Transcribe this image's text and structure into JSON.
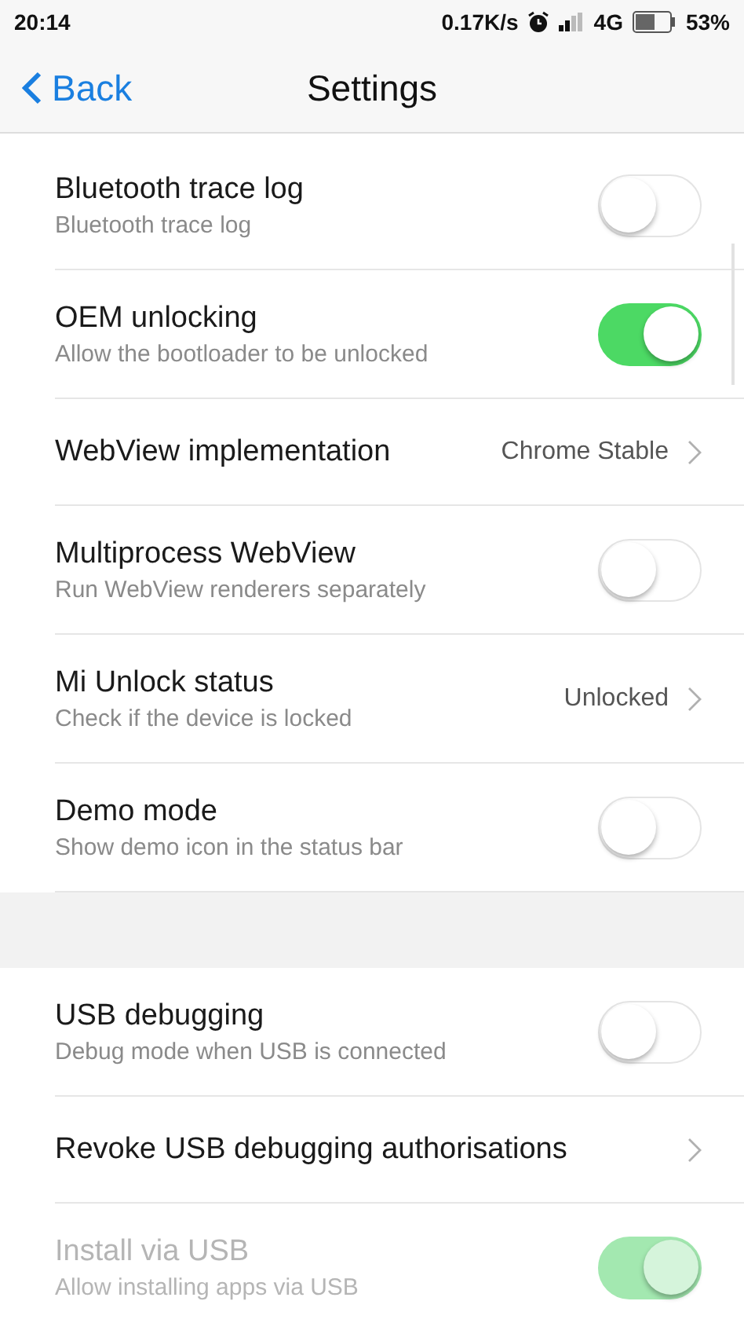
{
  "status_bar": {
    "time": "20:14",
    "speed": "0.17K/s",
    "network": "4G",
    "battery": "53%"
  },
  "nav": {
    "back": "Back",
    "title": "Settings"
  },
  "sections": [
    {
      "rows": [
        {
          "kind": "toggle",
          "title": "Bluetooth trace log",
          "subtitle": "Bluetooth trace log",
          "on": false,
          "disabled": false
        },
        {
          "kind": "toggle",
          "title": "OEM unlocking",
          "subtitle": "Allow the bootloader to be unlocked",
          "on": true,
          "disabled": false
        },
        {
          "kind": "link",
          "title": "WebView implementation",
          "value": "Chrome Stable"
        },
        {
          "kind": "toggle",
          "title": "Multiprocess WebView",
          "subtitle": "Run WebView renderers separately",
          "on": false,
          "disabled": false
        },
        {
          "kind": "link",
          "title": "Mi Unlock status",
          "subtitle": "Check if the device is locked",
          "value": "Unlocked"
        },
        {
          "kind": "toggle",
          "title": "Demo mode",
          "subtitle": "Show demo icon in the status bar",
          "on": false,
          "disabled": false
        }
      ]
    },
    {
      "rows": [
        {
          "kind": "toggle",
          "title": "USB debugging",
          "subtitle": "Debug mode when USB is connected",
          "on": false,
          "disabled": false
        },
        {
          "kind": "link",
          "title": "Revoke USB debugging authorisations"
        },
        {
          "kind": "toggle",
          "title": "Install via USB",
          "subtitle": "Allow installing apps via USB",
          "on": true,
          "disabled": true
        }
      ]
    }
  ]
}
